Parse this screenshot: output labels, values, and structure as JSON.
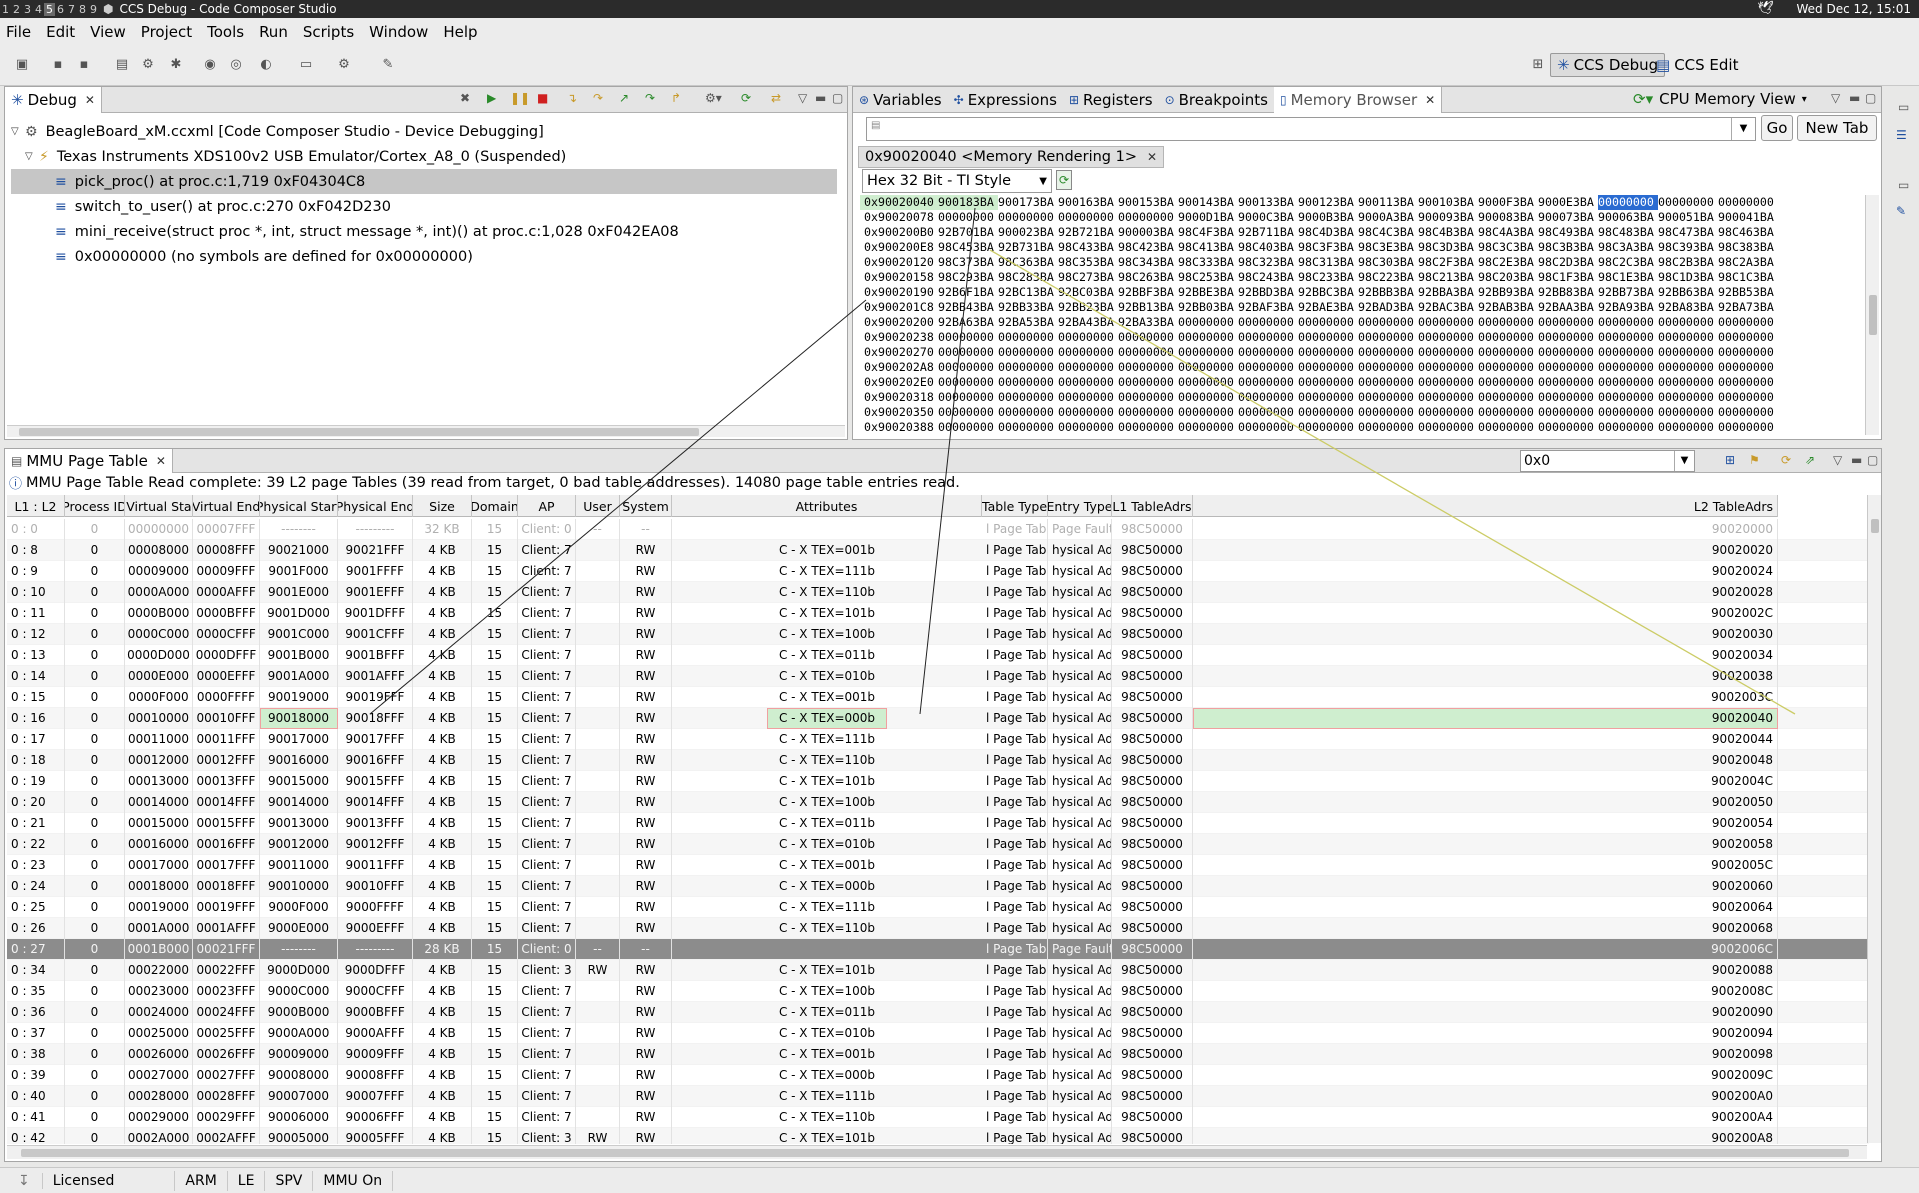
{
  "system": {
    "workspaces": [
      "1",
      "2",
      "3",
      "4",
      "5",
      "6",
      "7",
      "8",
      "9"
    ],
    "current_workspace": "5",
    "window_title": "CCS Debug - Code Composer Studio",
    "clock": "Wed Dec 12, 15:01"
  },
  "menu": [
    "File",
    "Edit",
    "View",
    "Project",
    "Tools",
    "Run",
    "Scripts",
    "Window",
    "Help"
  ],
  "perspectives": {
    "debug": "CCS Debug",
    "edit": "CCS Edit"
  },
  "debug_view": {
    "tab_label": "Debug",
    "items": [
      {
        "label": "BeagleBoard_xM.ccxml [Code Composer Studio - Device Debugging]",
        "level": 0
      },
      {
        "label": "Texas Instruments XDS100v2 USB Emulator/Cortex_A8_0 (Suspended)",
        "level": 1
      },
      {
        "label": "pick_proc() at proc.c:1,719 0xF04304C8",
        "level": 2,
        "selected": true
      },
      {
        "label": "switch_to_user() at proc.c:270 0xF042D230",
        "level": 2
      },
      {
        "label": "mini_receive(struct proc *, int, struct message *, int)() at proc.c:1,028 0xF042EA08",
        "level": 2
      },
      {
        "label": "0x00000000  (no symbols are defined for 0x00000000)",
        "level": 2
      }
    ]
  },
  "memory_view": {
    "tabs": [
      "Variables",
      "Expressions",
      "Registers",
      "Breakpoints",
      "Memory Browser"
    ],
    "active_tab": "Memory Browser",
    "mode": "CPU Memory View",
    "address_input": "",
    "go_label": "Go",
    "new_tab_label": "New Tab",
    "rendering_tab": "0x90020040 <Memory Rendering 1>",
    "format": "Hex 32 Bit - TI Style",
    "rows": [
      {
        "addr": "0x90020040",
        "cells": [
          "900183BA",
          "900173BA",
          "900163BA",
          "900153BA",
          "900143BA",
          "900133BA",
          "900123BA",
          "900113BA",
          "900103BA",
          "9000F3BA",
          "9000E3BA",
          "00000000",
          "00000000",
          "00000000"
        ]
      },
      {
        "addr": "0x90020078",
        "cells": [
          "00000000",
          "00000000",
          "00000000",
          "00000000",
          "9000D1BA",
          "9000C3BA",
          "9000B3BA",
          "9000A3BA",
          "900093BA",
          "900083BA",
          "900073BA",
          "900063BA",
          "900051BA",
          "900041BA"
        ]
      },
      {
        "addr": "0x900200B0",
        "cells": [
          "92B701BA",
          "900023BA",
          "92B721BA",
          "900003BA",
          "98C4F3BA",
          "92B711BA",
          "98C4D3BA",
          "98C4C3BA",
          "98C4B3BA",
          "98C4A3BA",
          "98C493BA",
          "98C483BA",
          "98C473BA",
          "98C463BA"
        ]
      },
      {
        "addr": "0x900200E8",
        "cells": [
          "98C453BA",
          "92B731BA",
          "98C433BA",
          "98C423BA",
          "98C413BA",
          "98C403BA",
          "98C3F3BA",
          "98C3E3BA",
          "98C3D3BA",
          "98C3C3BA",
          "98C3B3BA",
          "98C3A3BA",
          "98C393BA",
          "98C383BA"
        ]
      },
      {
        "addr": "0x90020120",
        "cells": [
          "98C373BA",
          "98C363BA",
          "98C353BA",
          "98C343BA",
          "98C333BA",
          "98C323BA",
          "98C313BA",
          "98C303BA",
          "98C2F3BA",
          "98C2E3BA",
          "98C2D3BA",
          "98C2C3BA",
          "98C2B3BA",
          "98C2A3BA"
        ]
      },
      {
        "addr": "0x90020158",
        "cells": [
          "98C293BA",
          "98C283BA",
          "98C273BA",
          "98C263BA",
          "98C253BA",
          "98C243BA",
          "98C233BA",
          "98C223BA",
          "98C213BA",
          "98C203BA",
          "98C1F3BA",
          "98C1E3BA",
          "98C1D3BA",
          "98C1C3BA"
        ]
      },
      {
        "addr": "0x90020190",
        "cells": [
          "92B6F1BA",
          "92BC13BA",
          "92BC03BA",
          "92BBF3BA",
          "92BBE3BA",
          "92BBD3BA",
          "92BBC3BA",
          "92BBB3BA",
          "92BBA3BA",
          "92BB93BA",
          "92BB83BA",
          "92BB73BA",
          "92BB63BA",
          "92BB53BA"
        ]
      },
      {
        "addr": "0x900201C8",
        "cells": [
          "92BB43BA",
          "92BB33BA",
          "92BB23BA",
          "92BB13BA",
          "92BB03BA",
          "92BAF3BA",
          "92BAE3BA",
          "92BAD3BA",
          "92BAC3BA",
          "92BAB3BA",
          "92BAA3BA",
          "92BA93BA",
          "92BA83BA",
          "92BA73BA"
        ]
      },
      {
        "addr": "0x90020200",
        "cells": [
          "92BA63BA",
          "92BA53BA",
          "92BA43BA",
          "92BA33BA",
          "00000000",
          "00000000",
          "00000000",
          "00000000",
          "00000000",
          "00000000",
          "00000000",
          "00000000",
          "00000000",
          "00000000"
        ]
      },
      {
        "addr": "0x90020238",
        "cells": [
          "00000000",
          "00000000",
          "00000000",
          "00000000",
          "00000000",
          "00000000",
          "00000000",
          "00000000",
          "00000000",
          "00000000",
          "00000000",
          "00000000",
          "00000000",
          "00000000"
        ]
      },
      {
        "addr": "0x90020270",
        "cells": [
          "00000000",
          "00000000",
          "00000000",
          "00000000",
          "00000000",
          "00000000",
          "00000000",
          "00000000",
          "00000000",
          "00000000",
          "00000000",
          "00000000",
          "00000000",
          "00000000"
        ]
      },
      {
        "addr": "0x900202A8",
        "cells": [
          "00000000",
          "00000000",
          "00000000",
          "00000000",
          "00000000",
          "00000000",
          "00000000",
          "00000000",
          "00000000",
          "00000000",
          "00000000",
          "00000000",
          "00000000",
          "00000000"
        ]
      },
      {
        "addr": "0x900202E0",
        "cells": [
          "00000000",
          "00000000",
          "00000000",
          "00000000",
          "00000000",
          "00000000",
          "00000000",
          "00000000",
          "00000000",
          "00000000",
          "00000000",
          "00000000",
          "00000000",
          "00000000"
        ]
      },
      {
        "addr": "0x90020318",
        "cells": [
          "00000000",
          "00000000",
          "00000000",
          "00000000",
          "00000000",
          "00000000",
          "00000000",
          "00000000",
          "00000000",
          "00000000",
          "00000000",
          "00000000",
          "00000000",
          "00000000"
        ]
      },
      {
        "addr": "0x90020350",
        "cells": [
          "00000000",
          "00000000",
          "00000000",
          "00000000",
          "00000000",
          "00000000",
          "00000000",
          "00000000",
          "00000000",
          "00000000",
          "00000000",
          "00000000",
          "00000000",
          "00000000"
        ]
      },
      {
        "addr": "0x90020388",
        "cells": [
          "00000000",
          "00000000",
          "00000000",
          "00000000",
          "00000000",
          "00000000",
          "00000000",
          "00000000",
          "00000000",
          "00000000",
          "00000000",
          "00000000",
          "00000000",
          "00000000"
        ]
      }
    ]
  },
  "mmu": {
    "tab_label": "MMU Page Table",
    "filter": "0x0",
    "info": "MMU Page Table Read complete:  39 L2 page Tables (39 read from target, 0 bad table addresses). 14080 page table entries read.",
    "columns": [
      "L1 : L2",
      "Process ID",
      "Virtual Start",
      "Virtual End",
      "Physical Start",
      "Physical End",
      "Size",
      "Domain",
      "AP",
      "User",
      "System",
      "Attributes",
      "Table Type",
      "Entry Type",
      "L1 TableAdrs",
      "L2 TableAdrs"
    ],
    "rows": [
      [
        "0 : 0",
        "0",
        "00000000",
        "00007FFF",
        "--------",
        "---------",
        "32 KB",
        "15",
        "Client: 0",
        "--",
        "--",
        "",
        "l Page Table",
        "Page Fault",
        "98C50000",
        "90020000"
      ],
      [
        "0 : 8",
        "0",
        "00008000",
        "00008FFF",
        "90021000",
        "90021FFF",
        "4 KB",
        "15",
        "Client: 7",
        "",
        "RW",
        "C - X TEX=001b",
        "l Page Table",
        "hysical Adr",
        "98C50000",
        "90020020"
      ],
      [
        "0 : 9",
        "0",
        "00009000",
        "00009FFF",
        "9001F000",
        "9001FFFF",
        "4 KB",
        "15",
        "Client: 7",
        "",
        "RW",
        "C - X TEX=111b",
        "l Page Table",
        "hysical Adr",
        "98C50000",
        "90020024"
      ],
      [
        "0 : 10",
        "0",
        "0000A000",
        "0000AFFF",
        "9001E000",
        "9001EFFF",
        "4 KB",
        "15",
        "Client: 7",
        "",
        "RW",
        "C - X TEX=110b",
        "l Page Table",
        "hysical Adr",
        "98C50000",
        "90020028"
      ],
      [
        "0 : 11",
        "0",
        "0000B000",
        "0000BFFF",
        "9001D000",
        "9001DFFF",
        "4 KB",
        "15",
        "Client: 7",
        "",
        "RW",
        "C - X TEX=101b",
        "l Page Table",
        "hysical Adr",
        "98C50000",
        "9002002C"
      ],
      [
        "0 : 12",
        "0",
        "0000C000",
        "0000CFFF",
        "9001C000",
        "9001CFFF",
        "4 KB",
        "15",
        "Client: 7",
        "",
        "RW",
        "C - X TEX=100b",
        "l Page Table",
        "hysical Adr",
        "98C50000",
        "90020030"
      ],
      [
        "0 : 13",
        "0",
        "0000D000",
        "0000DFFF",
        "9001B000",
        "9001BFFF",
        "4 KB",
        "15",
        "Client: 7",
        "",
        "RW",
        "C - X TEX=011b",
        "l Page Table",
        "hysical Adr",
        "98C50000",
        "90020034"
      ],
      [
        "0 : 14",
        "0",
        "0000E000",
        "0000EFFF",
        "9001A000",
        "9001AFFF",
        "4 KB",
        "15",
        "Client: 7",
        "",
        "RW",
        "C - X TEX=010b",
        "l Page Table",
        "hysical Adr",
        "98C50000",
        "90020038"
      ],
      [
        "0 : 15",
        "0",
        "0000F000",
        "0000FFFF",
        "90019000",
        "90019FFF",
        "4 KB",
        "15",
        "Client: 7",
        "",
        "RW",
        "C - X TEX=001b",
        "l Page Table",
        "hysical Adr",
        "98C50000",
        "9002003C"
      ],
      [
        "0 : 16",
        "0",
        "00010000",
        "00010FFF",
        "90018000",
        "90018FFF",
        "4 KB",
        "15",
        "Client: 7",
        "",
        "RW",
        "C - X TEX=000b",
        "l Page Table",
        "hysical Adr",
        "98C50000",
        "90020040"
      ],
      [
        "0 : 17",
        "0",
        "00011000",
        "00011FFF",
        "90017000",
        "90017FFF",
        "4 KB",
        "15",
        "Client: 7",
        "",
        "RW",
        "C - X TEX=111b",
        "l Page Table",
        "hysical Adr",
        "98C50000",
        "90020044"
      ],
      [
        "0 : 18",
        "0",
        "00012000",
        "00012FFF",
        "90016000",
        "90016FFF",
        "4 KB",
        "15",
        "Client: 7",
        "",
        "RW",
        "C - X TEX=110b",
        "l Page Table",
        "hysical Adr",
        "98C50000",
        "90020048"
      ],
      [
        "0 : 19",
        "0",
        "00013000",
        "00013FFF",
        "90015000",
        "90015FFF",
        "4 KB",
        "15",
        "Client: 7",
        "",
        "RW",
        "C - X TEX=101b",
        "l Page Table",
        "hysical Adr",
        "98C50000",
        "9002004C"
      ],
      [
        "0 : 20",
        "0",
        "00014000",
        "00014FFF",
        "90014000",
        "90014FFF",
        "4 KB",
        "15",
        "Client: 7",
        "",
        "RW",
        "C - X TEX=100b",
        "l Page Table",
        "hysical Adr",
        "98C50000",
        "90020050"
      ],
      [
        "0 : 21",
        "0",
        "00015000",
        "00015FFF",
        "90013000",
        "90013FFF",
        "4 KB",
        "15",
        "Client: 7",
        "",
        "RW",
        "C - X TEX=011b",
        "l Page Table",
        "hysical Adr",
        "98C50000",
        "90020054"
      ],
      [
        "0 : 22",
        "0",
        "00016000",
        "00016FFF",
        "90012000",
        "90012FFF",
        "4 KB",
        "15",
        "Client: 7",
        "",
        "RW",
        "C - X TEX=010b",
        "l Page Table",
        "hysical Adr",
        "98C50000",
        "90020058"
      ],
      [
        "0 : 23",
        "0",
        "00017000",
        "00017FFF",
        "90011000",
        "90011FFF",
        "4 KB",
        "15",
        "Client: 7",
        "",
        "RW",
        "C - X TEX=001b",
        "l Page Table",
        "hysical Adr",
        "98C50000",
        "9002005C"
      ],
      [
        "0 : 24",
        "0",
        "00018000",
        "00018FFF",
        "90010000",
        "90010FFF",
        "4 KB",
        "15",
        "Client: 7",
        "",
        "RW",
        "C - X TEX=000b",
        "l Page Table",
        "hysical Adr",
        "98C50000",
        "90020060"
      ],
      [
        "0 : 25",
        "0",
        "00019000",
        "00019FFF",
        "9000F000",
        "9000FFFF",
        "4 KB",
        "15",
        "Client: 7",
        "",
        "RW",
        "C - X TEX=111b",
        "l Page Table",
        "hysical Adr",
        "98C50000",
        "90020064"
      ],
      [
        "0 : 26",
        "0",
        "0001A000",
        "0001AFFF",
        "9000E000",
        "9000EFFF",
        "4 KB",
        "15",
        "Client: 7",
        "",
        "RW",
        "C - X TEX=110b",
        "l Page Table",
        "hysical Adr",
        "98C50000",
        "90020068"
      ],
      [
        "0 : 27",
        "0",
        "0001B000",
        "00021FFF",
        "--------",
        "---------",
        "28 KB",
        "15",
        "Client: 0",
        "--",
        "--",
        "",
        "l Page Table",
        "Page Fault",
        "98C50000",
        "9002006C"
      ],
      [
        "0 : 34",
        "0",
        "00022000",
        "00022FFF",
        "9000D000",
        "9000DFFF",
        "4 KB",
        "15",
        "Client: 3",
        "RW",
        "RW",
        "C - X TEX=101b",
        "l Page Table",
        "hysical Adr",
        "98C50000",
        "90020088"
      ],
      [
        "0 : 35",
        "0",
        "00023000",
        "00023FFF",
        "9000C000",
        "9000CFFF",
        "4 KB",
        "15",
        "Client: 7",
        "",
        "RW",
        "C - X TEX=100b",
        "l Page Table",
        "hysical Adr",
        "98C50000",
        "9002008C"
      ],
      [
        "0 : 36",
        "0",
        "00024000",
        "00024FFF",
        "9000B000",
        "9000BFFF",
        "4 KB",
        "15",
        "Client: 7",
        "",
        "RW",
        "C - X TEX=011b",
        "l Page Table",
        "hysical Adr",
        "98C50000",
        "90020090"
      ],
      [
        "0 : 37",
        "0",
        "00025000",
        "00025FFF",
        "9000A000",
        "9000AFFF",
        "4 KB",
        "15",
        "Client: 7",
        "",
        "RW",
        "C - X TEX=010b",
        "l Page Table",
        "hysical Adr",
        "98C50000",
        "90020094"
      ],
      [
        "0 : 38",
        "0",
        "00026000",
        "00026FFF",
        "90009000",
        "90009FFF",
        "4 KB",
        "15",
        "Client: 7",
        "",
        "RW",
        "C - X TEX=001b",
        "l Page Table",
        "hysical Adr",
        "98C50000",
        "90020098"
      ],
      [
        "0 : 39",
        "0",
        "00027000",
        "00027FFF",
        "90008000",
        "90008FFF",
        "4 KB",
        "15",
        "Client: 7",
        "",
        "RW",
        "C - X TEX=000b",
        "l Page Table",
        "hysical Adr",
        "98C50000",
        "9002009C"
      ],
      [
        "0 : 40",
        "0",
        "00028000",
        "00028FFF",
        "90007000",
        "90007FFF",
        "4 KB",
        "15",
        "Client: 7",
        "",
        "RW",
        "C - X TEX=111b",
        "l Page Table",
        "hysical Adr",
        "98C50000",
        "900200A0"
      ],
      [
        "0 : 41",
        "0",
        "00029000",
        "00029FFF",
        "90006000",
        "90006FFF",
        "4 KB",
        "15",
        "Client: 7",
        "",
        "RW",
        "C - X TEX=110b",
        "l Page Table",
        "hysical Adr",
        "98C50000",
        "900200A4"
      ],
      [
        "0 : 42",
        "0",
        "0002A000",
        "0002AFFF",
        "90005000",
        "90005FFF",
        "4 KB",
        "15",
        "Client: 3",
        "RW",
        "RW",
        "C - X TEX=101b",
        "l Page Table",
        "hysical Adr",
        "98C50000",
        "900200A8"
      ]
    ]
  },
  "status": [
    "Licensed",
    "ARM",
    "LE",
    "SPV",
    "MMU On"
  ]
}
